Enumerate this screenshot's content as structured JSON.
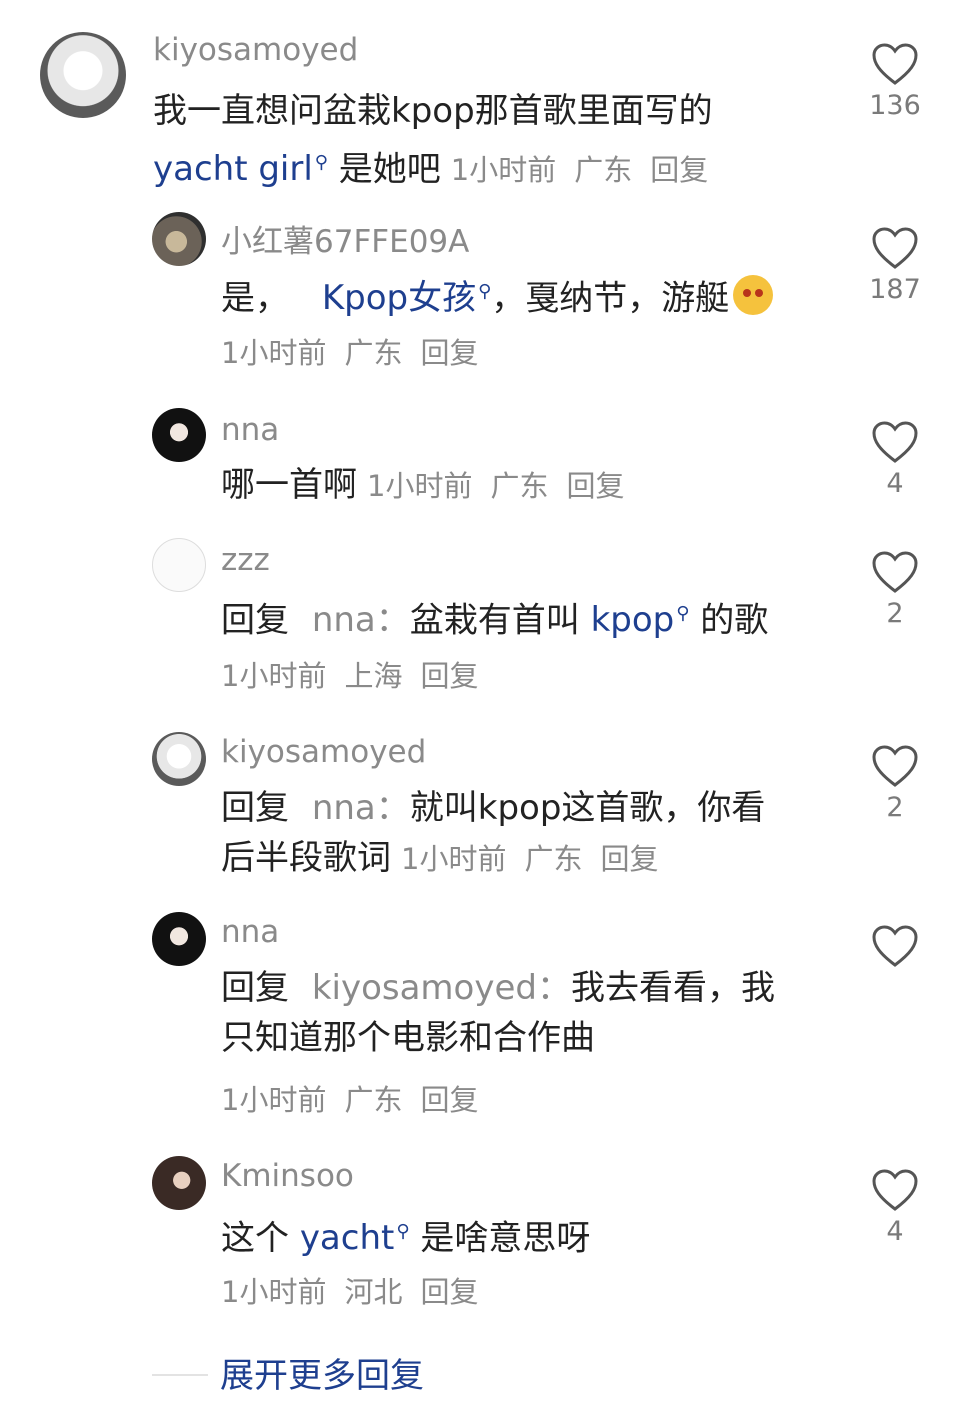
{
  "heart_icon": "heart-outline",
  "colors": {
    "link": "#1e3f8f",
    "meta": "#8a8a8a",
    "text": "#222222"
  },
  "comments": [
    {
      "username": "kiyosamoyed",
      "line1": "我一直想问盆栽kpop那首歌里面写的",
      "link": "yacht girl",
      "after_link": " 是她吧",
      "time": "1小时前",
      "location": "广东",
      "reply": "回复",
      "likes": "136"
    },
    {
      "username": "小红薯67FFE09A",
      "before_link": "是，",
      "link": "Kpop女孩",
      "after_link": "，戛纳节，游艇",
      "time": "1小时前",
      "location": "广东",
      "reply": "回复",
      "likes": "187"
    },
    {
      "username": "nna",
      "text": "哪一首啊",
      "time": "1小时前",
      "location": "广东",
      "reply": "回复",
      "likes": "4"
    },
    {
      "username": "zzz",
      "reply_prefix": "回复",
      "reply_to": "nna：",
      "before_link": "盆栽有首叫 ",
      "link": "kpop",
      "after_link": " 的歌",
      "time": "1小时前",
      "location": "上海",
      "reply": "回复",
      "likes": "2"
    },
    {
      "username": "kiyosamoyed",
      "reply_prefix": "回复",
      "reply_to": "nna：",
      "line1": "就叫kpop这首歌，你看",
      "line2": "后半段歌词",
      "time": "1小时前",
      "location": "广东",
      "reply": "回复",
      "likes": "2"
    },
    {
      "username": "nna",
      "reply_prefix": "回复",
      "reply_to": "kiyosamoyed：",
      "line1": "我去看看，我",
      "line2": "只知道那个电影和合作曲",
      "time": "1小时前",
      "location": "广东",
      "reply": "回复",
      "likes": ""
    },
    {
      "username": "Kminsoo",
      "before_link": "这个 ",
      "link": "yacht",
      "after_link": " 是啥意思呀",
      "time": "1小时前",
      "location": "河北",
      "reply": "回复",
      "likes": "4"
    }
  ],
  "expand_more": "展开更多回复"
}
